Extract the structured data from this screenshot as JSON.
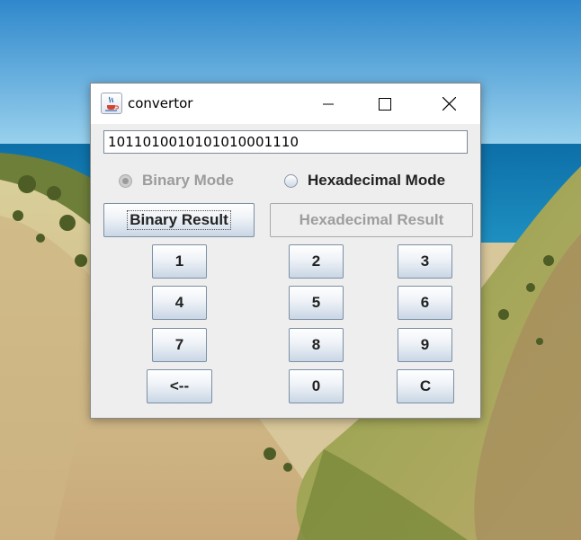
{
  "window": {
    "title": "convertor",
    "controls": {
      "minimize": "minimize",
      "maximize": "maximize",
      "close": "close"
    }
  },
  "input": {
    "value": "1011010010101010001110"
  },
  "modes": {
    "binary": {
      "label": "Binary Mode",
      "selected": true,
      "enabled": false
    },
    "hexadecimal": {
      "label": "Hexadecimal Mode",
      "selected": false,
      "enabled": true
    }
  },
  "results": {
    "binary_label": "Binary Result",
    "hex_label": "Hexadecimal Result"
  },
  "keypad": {
    "k1": "1",
    "k2": "2",
    "k3": "3",
    "k4": "4",
    "k5": "5",
    "k6": "6",
    "k7": "7",
    "k8": "8",
    "k9": "9",
    "back": "<--",
    "k0": "0",
    "clear": "C"
  },
  "colors": {
    "window_bg": "#eeeeee",
    "titlebar_bg": "#ffffff",
    "disabled_text": "#9c9c9c",
    "button_gradient_top": "#ffffff",
    "button_gradient_bottom": "#c9d6e5"
  }
}
